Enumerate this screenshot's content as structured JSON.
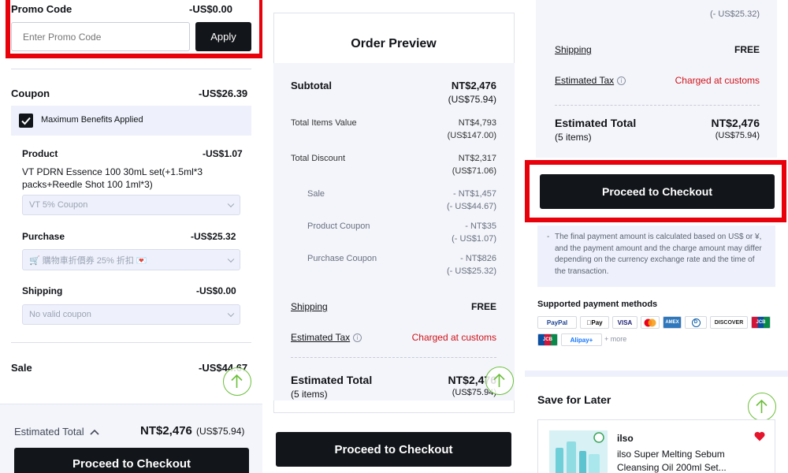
{
  "left": {
    "promo": {
      "label": "Promo Code",
      "amount": "-US$0.00",
      "placeholder": "Enter Promo Code",
      "apply": "Apply"
    },
    "coupon": {
      "label": "Coupon",
      "amount": "-US$26.39",
      "max_benefits": "Maximum Benefits Applied",
      "product": {
        "label": "Product",
        "amount": "-US$1.07",
        "name": "VT PDRN Essence 100 30mL set(+1.5ml*3 packs+Reedle Shot 100 1ml*3)",
        "select": "VT 5% Coupon"
      },
      "purchase": {
        "label": "Purchase",
        "amount": "-US$25.32",
        "select": "🛒 購物車折價券 25% 折扣 💌"
      },
      "shipping": {
        "label": "Shipping",
        "amount": "-US$0.00",
        "select": "No valid coupon"
      }
    },
    "sale": {
      "label": "Sale",
      "amount": "-US$44.67"
    },
    "footer": {
      "estimated_total": "Estimated Total",
      "amount": "NT$2,476",
      "usd": "(US$75.94)",
      "checkout": "Proceed to Checkout"
    }
  },
  "middle": {
    "title": "Order Preview",
    "subtotal": {
      "label": "Subtotal",
      "value": "NT$2,476",
      "usd": "(US$75.94)"
    },
    "items_value": {
      "label": "Total Items Value",
      "value": "NT$4,793",
      "usd": "(US$147.00)"
    },
    "total_discount": {
      "label": "Total Discount",
      "value": "NT$2,317",
      "usd": "(US$71.06)"
    },
    "sale": {
      "label": "Sale",
      "value": "- NT$1,457",
      "usd": "(- US$44.67)"
    },
    "product_coupon": {
      "label": "Product Coupon",
      "value": "- NT$35",
      "usd": "(- US$1.07)"
    },
    "purchase_coupon": {
      "label": "Purchase Coupon",
      "value": "- NT$826",
      "usd": "(- US$25.32)"
    },
    "shipping": {
      "label": "Shipping",
      "value": "FREE"
    },
    "tax": {
      "label": "Estimated Tax",
      "value": "Charged at customs"
    },
    "estimated_total": {
      "label": "Estimated Total",
      "items": "(5 items)",
      "value": "NT$2,476",
      "usd": "(US$75.94)"
    },
    "checkout": "Proceed to Checkout"
  },
  "right": {
    "top_usd": "(- US$25.32)",
    "shipping": {
      "label": "Shipping",
      "value": "FREE"
    },
    "tax": {
      "label": "Estimated Tax",
      "value": "Charged at customs"
    },
    "estimated_total": {
      "label": "Estimated Total",
      "items": "(5 items)",
      "value": "NT$2,476",
      "usd": "(US$75.94)"
    },
    "checkout": "Proceed to Checkout",
    "note": "The final payment amount is calculated based on US$ or ¥, and the payment amount and the charge amount may differ depending on the currency exchange rate and the time of the transaction.",
    "payment_title": "Supported payment methods",
    "payments": [
      "PayPal",
      "Pay",
      "VISA",
      "",
      "AMEX",
      "D",
      "DISCOVER",
      "JCB",
      "JCB",
      "Alipay+"
    ],
    "more": "+ more",
    "save_later": "Save for Later",
    "item": {
      "brand": "ilso",
      "name": "ilso Super Melting Sebum Cleansing Oil 200ml Set..."
    }
  },
  "colors": {
    "accent_red": "#e8000b",
    "dark": "#121519",
    "green": "#6cbf3a",
    "tax_red": "#d0131a"
  }
}
